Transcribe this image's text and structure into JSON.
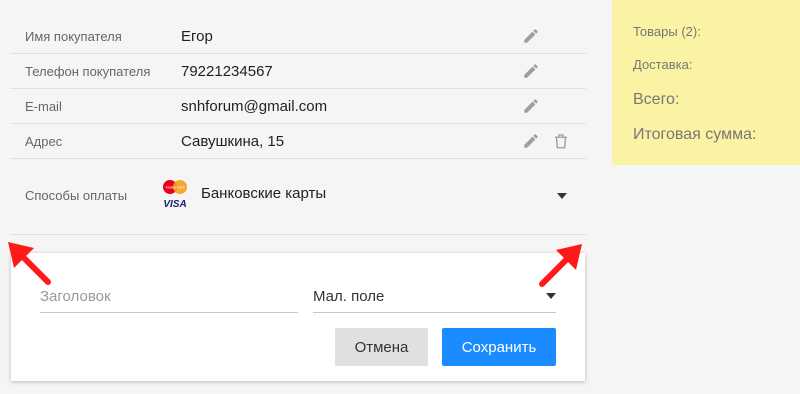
{
  "customer": {
    "rows": [
      {
        "label": "Имя покупателя",
        "value": "Егор"
      },
      {
        "label": "Телефон покупателя",
        "value": "79221234567"
      },
      {
        "label": "E-mail",
        "value": "snhforum@gmail.com"
      },
      {
        "label": "Адрес",
        "value": "Савушкина, 15"
      }
    ],
    "payment": {
      "label": "Способы оплаты",
      "value": "Банковские карты",
      "logo_text": "MasterCard",
      "visa_text": "VISA"
    }
  },
  "summary": {
    "goods": "Товары (2):",
    "delivery": "Доставка:",
    "total": "Всего:",
    "final": "Итоговая сумма:"
  },
  "form": {
    "title_placeholder": "Заголовок",
    "size_value": "Мал. поле",
    "cancel_label": "Отмена",
    "save_label": "Сохранить"
  },
  "colors": {
    "accent": "#1a8cff",
    "summary_bg": "#fbf3a4",
    "annotation_arrow": "#ff1a1a"
  },
  "icons": [
    "pencil-icon",
    "trash-icon",
    "dropdown-arrow-icon",
    "mastercard-logo",
    "visa-logo",
    "red-arrow"
  ]
}
